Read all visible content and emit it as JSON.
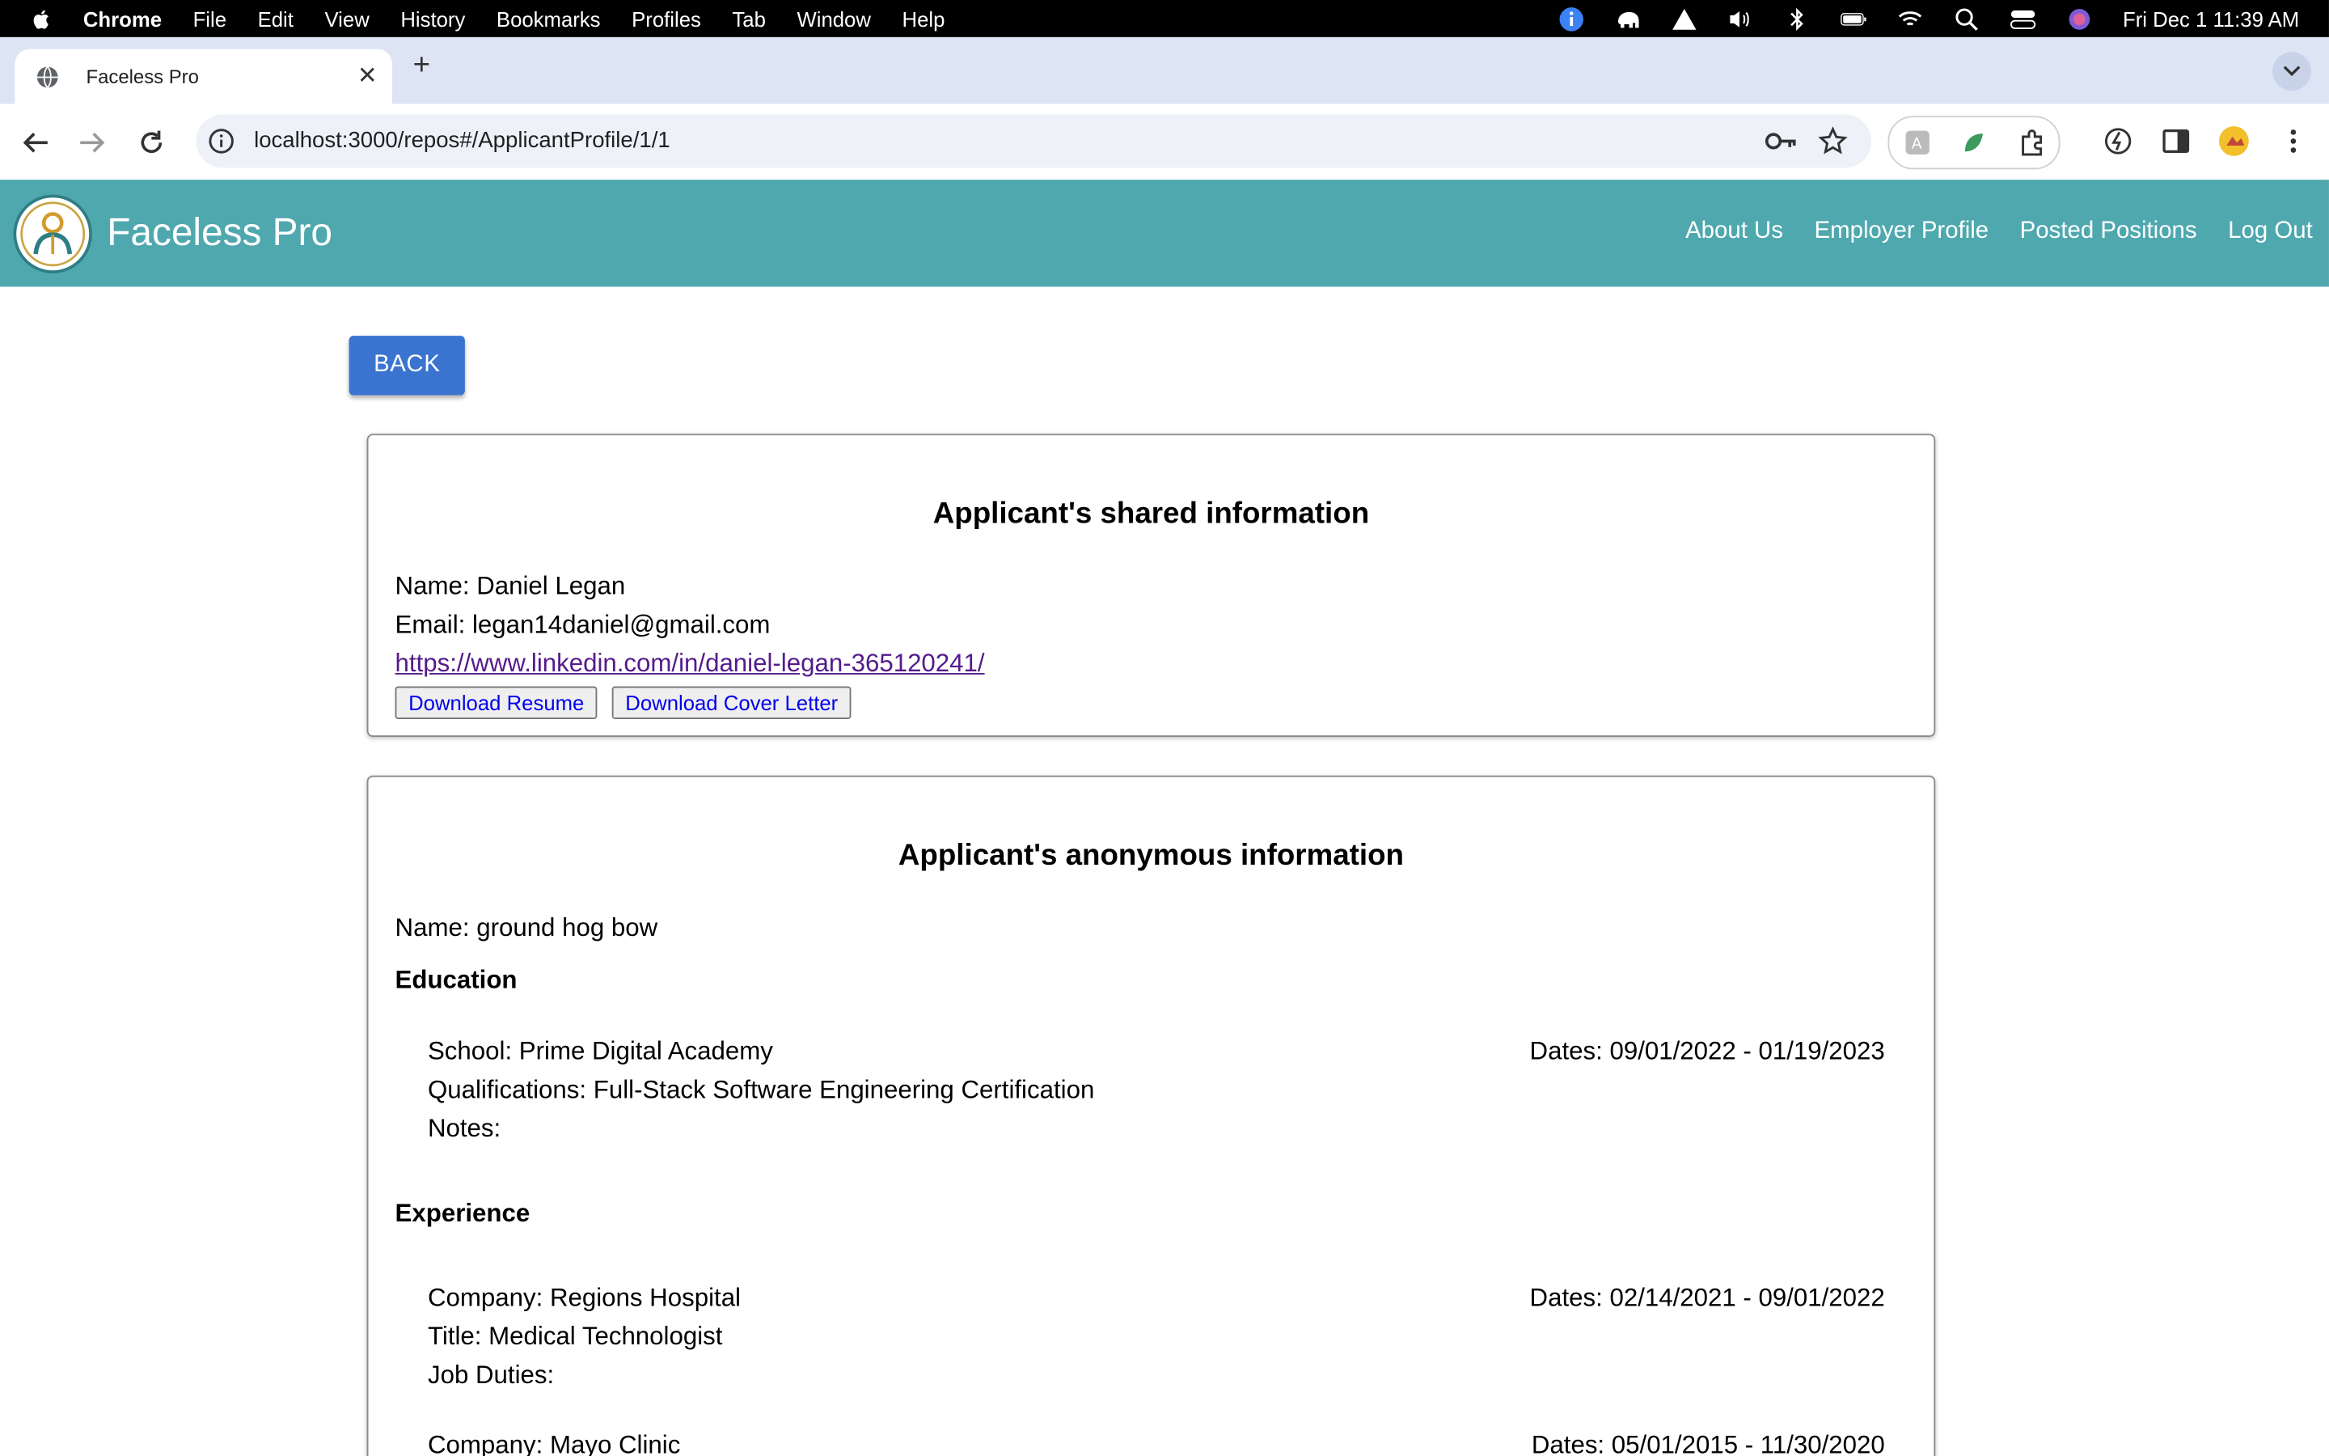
{
  "menubar": {
    "items": [
      "Chrome",
      "File",
      "Edit",
      "View",
      "History",
      "Bookmarks",
      "Profiles",
      "Tab",
      "Window",
      "Help"
    ],
    "datetime": "Fri Dec 1  11:39 AM"
  },
  "browser": {
    "tab_title": "Faceless Pro",
    "url": "localhost:3000/repos#/ApplicantProfile/1/1"
  },
  "app": {
    "brand": "Faceless Pro",
    "nav": [
      "About Us",
      "Employer Profile",
      "Posted Positions",
      "Log Out"
    ]
  },
  "back_label": "BACK",
  "shared": {
    "title": "Applicant's shared information",
    "name": "Name: Daniel Legan",
    "email": "Email: legan14daniel@gmail.com",
    "linkedin": "https://www.linkedin.com/in/daniel-legan-365120241/",
    "download_resume": "Download Resume",
    "download_cover": "Download Cover Letter"
  },
  "anonymous": {
    "title": "Applicant's anonymous information",
    "name": "Name: ground hog bow",
    "education_heading": "Education",
    "education": [
      {
        "school": "School: Prime Digital Academy",
        "qualifications": "Qualifications: Full-Stack Software Engineering Certification",
        "notes": "Notes:",
        "dates": "Dates: 09/01/2022 - 01/19/2023"
      }
    ],
    "experience_heading": "Experience",
    "experience": [
      {
        "company": "Company: Regions Hospital",
        "title": "Title: Medical Technologist",
        "duties": "Job Duties:",
        "dates": "Dates: 02/14/2021 - 09/01/2022"
      },
      {
        "company": "Company: Mayo Clinic",
        "dates": "Dates: 05/01/2015 - 11/30/2020"
      }
    ]
  }
}
